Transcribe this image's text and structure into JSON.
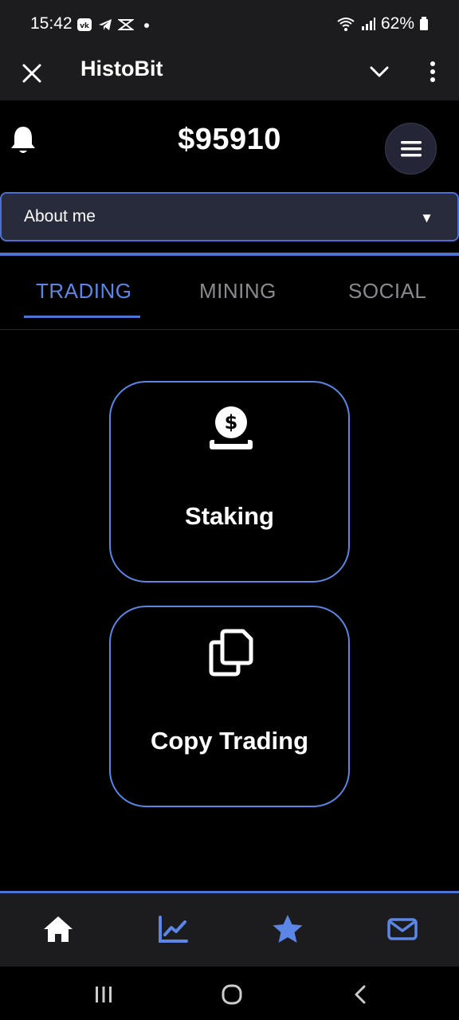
{
  "status_bar": {
    "time": "15:42",
    "battery": "62%",
    "left_icons": [
      "vk-icon",
      "telegram-icon",
      "capcut-icon",
      "dot-icon"
    ],
    "right_icons": [
      "wifi-icon",
      "signal-icon",
      "battery-icon"
    ]
  },
  "app_bar": {
    "title": "HistoBit",
    "icons": [
      "close-icon",
      "chevron-down-icon",
      "more-vert-icon"
    ]
  },
  "header": {
    "balance": "$95910",
    "icons": [
      "bell-icon",
      "hamburger-menu-icon"
    ]
  },
  "select": {
    "value": "About me",
    "arrow": "▼"
  },
  "tabs": [
    {
      "label": "TRADING",
      "active": true
    },
    {
      "label": "MINING",
      "active": false
    },
    {
      "label": "SOCIAL",
      "active": false
    }
  ],
  "cards": [
    {
      "label": "Staking",
      "icon": "coin-hand-icon"
    },
    {
      "label": "Copy Trading",
      "icon": "copy-icon"
    }
  ],
  "bottom_nav": [
    {
      "icon": "home-icon",
      "active": true
    },
    {
      "icon": "chart-line-icon",
      "active": false
    },
    {
      "icon": "star-icon",
      "active": false
    },
    {
      "icon": "mail-icon",
      "active": false
    }
  ],
  "system_nav": [
    "recents-icon",
    "home-circle-icon",
    "back-icon"
  ],
  "colors": {
    "accent": "#5b86e5",
    "border_blue": "#4c74d4",
    "bar_bg": "#1c1c1e",
    "select_bg": "#272b3c",
    "inactive_tab": "#8a8a8e"
  }
}
